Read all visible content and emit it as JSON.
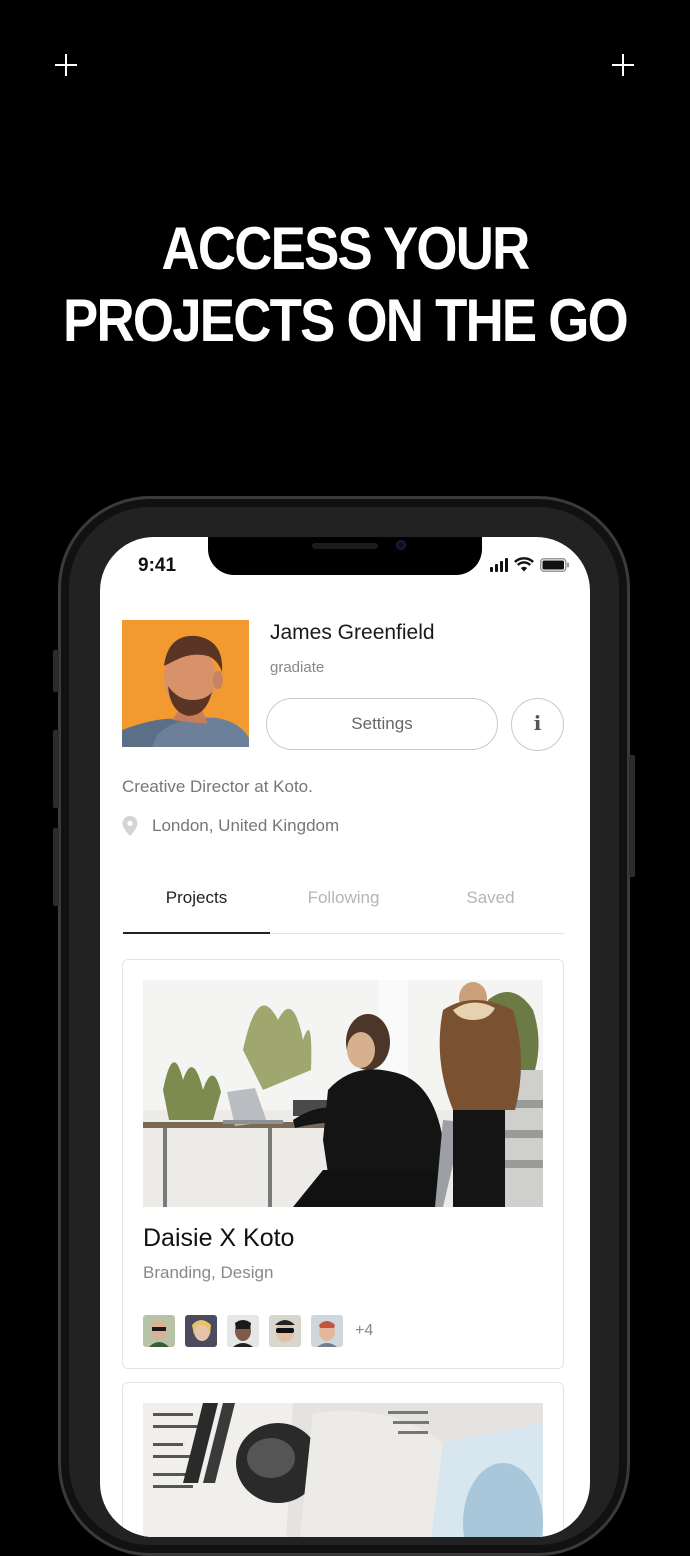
{
  "headline": {
    "line1": "ACCESS YOUR",
    "line2": "PROJECTS ON THE GO"
  },
  "status_bar": {
    "time": "9:41",
    "icons": [
      "signal-icon",
      "wifi-icon",
      "battery-icon"
    ]
  },
  "profile": {
    "name": "James Greenfield",
    "handle": "gradiate",
    "settings_label": "Settings",
    "info_label": "i",
    "bio": "Creative Director at Koto.",
    "location": "London, United Kingdom"
  },
  "tabs": [
    {
      "label": "Projects",
      "active": true
    },
    {
      "label": "Following",
      "active": false
    },
    {
      "label": "Saved",
      "active": false
    }
  ],
  "projects": [
    {
      "title": "Daisie X Koto",
      "tags": "Branding, Design",
      "collaborators_more": "+4"
    }
  ],
  "colors": {
    "background": "#000000",
    "accent_orange": "#f08a22",
    "text_dark": "#1a1a1a",
    "text_muted": "#888888"
  }
}
